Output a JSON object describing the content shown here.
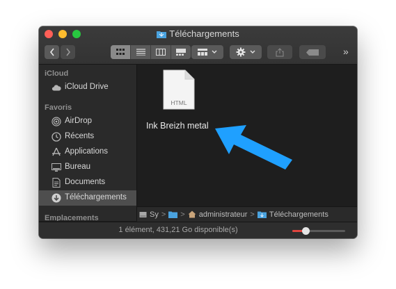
{
  "window": {
    "title": "Téléchargements"
  },
  "toolbar": {
    "back_icon": "chevron-left-icon",
    "forward_icon": "chevron-right-icon",
    "views": [
      "icon-view",
      "list-view",
      "column-view",
      "gallery-view"
    ],
    "active_view": "icon-view",
    "group_icon": "group-grid-icon",
    "action_icon": "gear-icon",
    "share_icon": "share-icon",
    "tag_icon": "tag-icon",
    "more_label": "»"
  },
  "sidebar": {
    "sections": [
      {
        "title": "iCloud",
        "items": [
          {
            "label": "iCloud Drive",
            "icon": "cloud-icon"
          }
        ]
      },
      {
        "title": "Favoris",
        "items": [
          {
            "label": "AirDrop",
            "icon": "airdrop-icon"
          },
          {
            "label": "Récents",
            "icon": "clock-icon"
          },
          {
            "label": "Applications",
            "icon": "applications-icon"
          },
          {
            "label": "Bureau",
            "icon": "desktop-icon"
          },
          {
            "label": "Documents",
            "icon": "document-icon"
          },
          {
            "label": "Téléchargements",
            "icon": "download-icon",
            "selected": true
          }
        ]
      },
      {
        "title": "Emplacements",
        "items": []
      }
    ]
  },
  "content": {
    "files": [
      {
        "name": "Ink Breizh metal",
        "type_label": "HTML"
      }
    ]
  },
  "pathbar": {
    "segments": [
      "Sy",
      "",
      "administrateur",
      "Téléchargements"
    ],
    "separator": ">"
  },
  "status": {
    "text": "1 élément, 431,21 Go disponible(s)",
    "zoom_level": 0.25
  },
  "colors": {
    "accent_arrow": "#1fa0ff",
    "slider_fill": "#e0443e",
    "folder_blue": "#4aa3df"
  }
}
